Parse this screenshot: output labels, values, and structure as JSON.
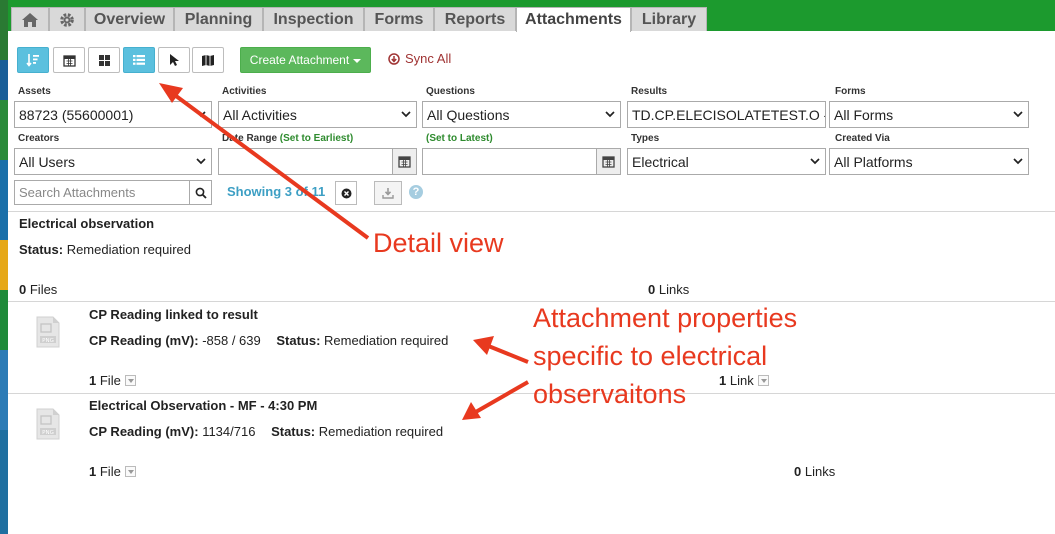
{
  "nav": {
    "tabs": [
      {
        "label": "Overview"
      },
      {
        "label": "Planning"
      },
      {
        "label": "Inspection"
      },
      {
        "label": "Forms"
      },
      {
        "label": "Reports"
      },
      {
        "label": "Attachments"
      },
      {
        "label": "Library"
      }
    ],
    "active_tab": "Attachments"
  },
  "toolbar": {
    "create_label": "Create Attachment",
    "sync_label": "Sync All",
    "active_view": "detail-view"
  },
  "filters": {
    "assets": {
      "label": "Assets",
      "value": "88723 (55600001)"
    },
    "activities": {
      "label": "Activities",
      "value": "All Activities"
    },
    "questions": {
      "label": "Questions",
      "value": "All Questions"
    },
    "results": {
      "label": "Results",
      "value": "TD.CP.ELECISOLATETEST.O - C"
    },
    "forms": {
      "label": "Forms",
      "value": "All Forms"
    },
    "creators": {
      "label": "Creators",
      "value": "All Users"
    },
    "date_range": {
      "label": "Date Range",
      "earliest_link": "(Set to Earliest)",
      "latest_link": "(Set to Latest)"
    },
    "types": {
      "label": "Types",
      "value": "Electrical"
    },
    "created_via": {
      "label": "Created Via",
      "value": "All Platforms"
    }
  },
  "search": {
    "placeholder": "Search Attachments"
  },
  "showing": "Showing 3 of 11",
  "attachments": [
    {
      "title": "Electrical observation",
      "status_label": "Status:",
      "status_value": "Remediation required",
      "files_count": "0",
      "files_label": "Files",
      "links_count": "0",
      "links_label": "Links"
    },
    {
      "title": "CP Reading linked to result",
      "cp_label": "CP Reading (mV):",
      "cp_value": "-858 / 639",
      "status_label": "Status:",
      "status_value": "Remediation required",
      "files_count": "1",
      "files_label": "File",
      "links_count": "1",
      "links_label": "Link",
      "file_type": "PNG"
    },
    {
      "title": "Electrical Observation - MF - 4:30 PM",
      "cp_label": "CP Reading (mV):",
      "cp_value": "1134/716",
      "status_label": "Status:",
      "status_value": "Remediation required",
      "files_count": "1",
      "files_label": "File",
      "links_count": "0",
      "links_label": "Links",
      "file_type": "PNG"
    }
  ],
  "annotations": {
    "detail_view": "Detail view",
    "properties_line1": "Attachment properties",
    "properties_line2": "specific to electrical",
    "properties_line3": "observaitons"
  },
  "colors": {
    "nav_green": "#1c9a2e",
    "active_view_blue": "#5bc0de",
    "create_green": "#5cb85c",
    "sync_red": "#a03434",
    "showing_blue": "#3d9fc4",
    "annotation_red": "#e8391f"
  }
}
